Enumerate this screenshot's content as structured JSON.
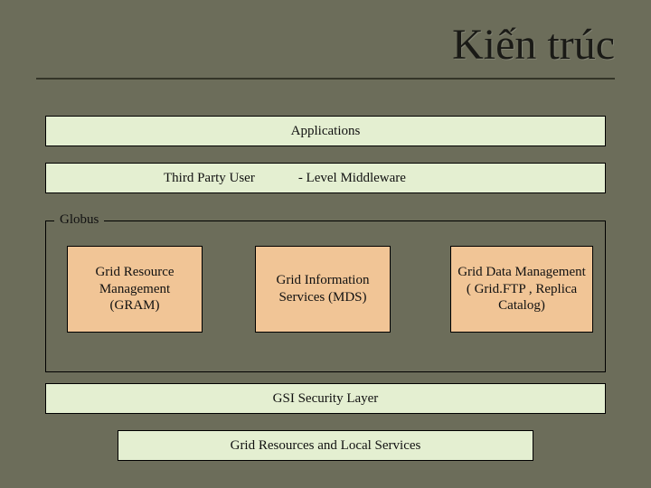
{
  "title": "Kiến trúc",
  "layers": {
    "applications": "Applications",
    "middleware_left": "Third Party User",
    "middleware_right": "- Level Middleware",
    "globus_label": "Globus",
    "gram": "Grid Resource Management (GRAM)",
    "mds": "Grid Information Services (MDS)",
    "data_mgmt": "Grid Data Management ( Grid.FTP   , Replica Catalog)",
    "gsi": "GSI Security Layer",
    "resources": "Grid Resources and Local Services"
  }
}
